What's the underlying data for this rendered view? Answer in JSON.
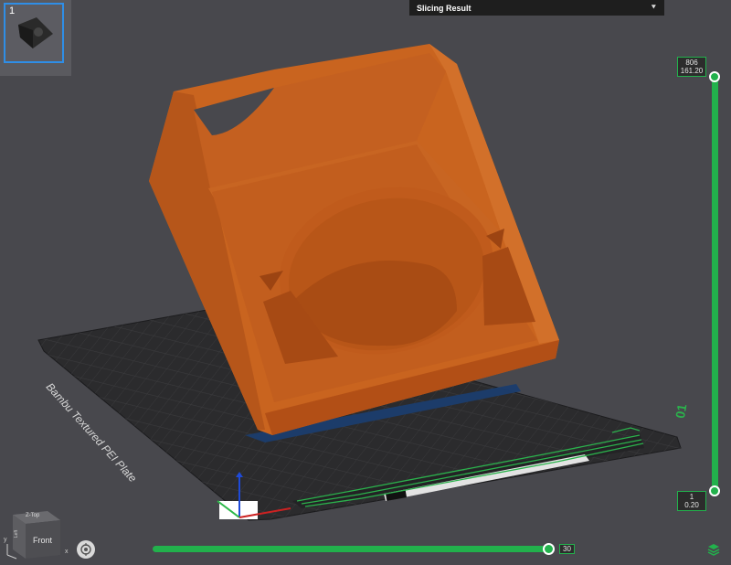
{
  "plate_thumbnail": {
    "index": "1"
  },
  "slicing_panel": {
    "title": "Slicing Result",
    "collapse_icon": "chevron-double-down-icon"
  },
  "bed": {
    "label": "Bambu Textured PEI Plate",
    "plate_number": "01"
  },
  "layer_slider": {
    "top_layer": "806",
    "top_height": "161.20",
    "bottom_layer": "1",
    "bottom_height": "0.20"
  },
  "move_slider": {
    "value": "30"
  },
  "view_cube": {
    "face_front": "Front",
    "face_top": "Z-Top",
    "face_side": "Left"
  },
  "axes": {
    "x": "x",
    "y": "y"
  },
  "colors": {
    "model": "#d2691e",
    "bed": "#2c2c2e",
    "accent_green": "#22b14c",
    "selection_blue": "#2f8ee6"
  },
  "icons": [
    "orient-icon",
    "layers-icon",
    "chevron-double-down-icon"
  ]
}
